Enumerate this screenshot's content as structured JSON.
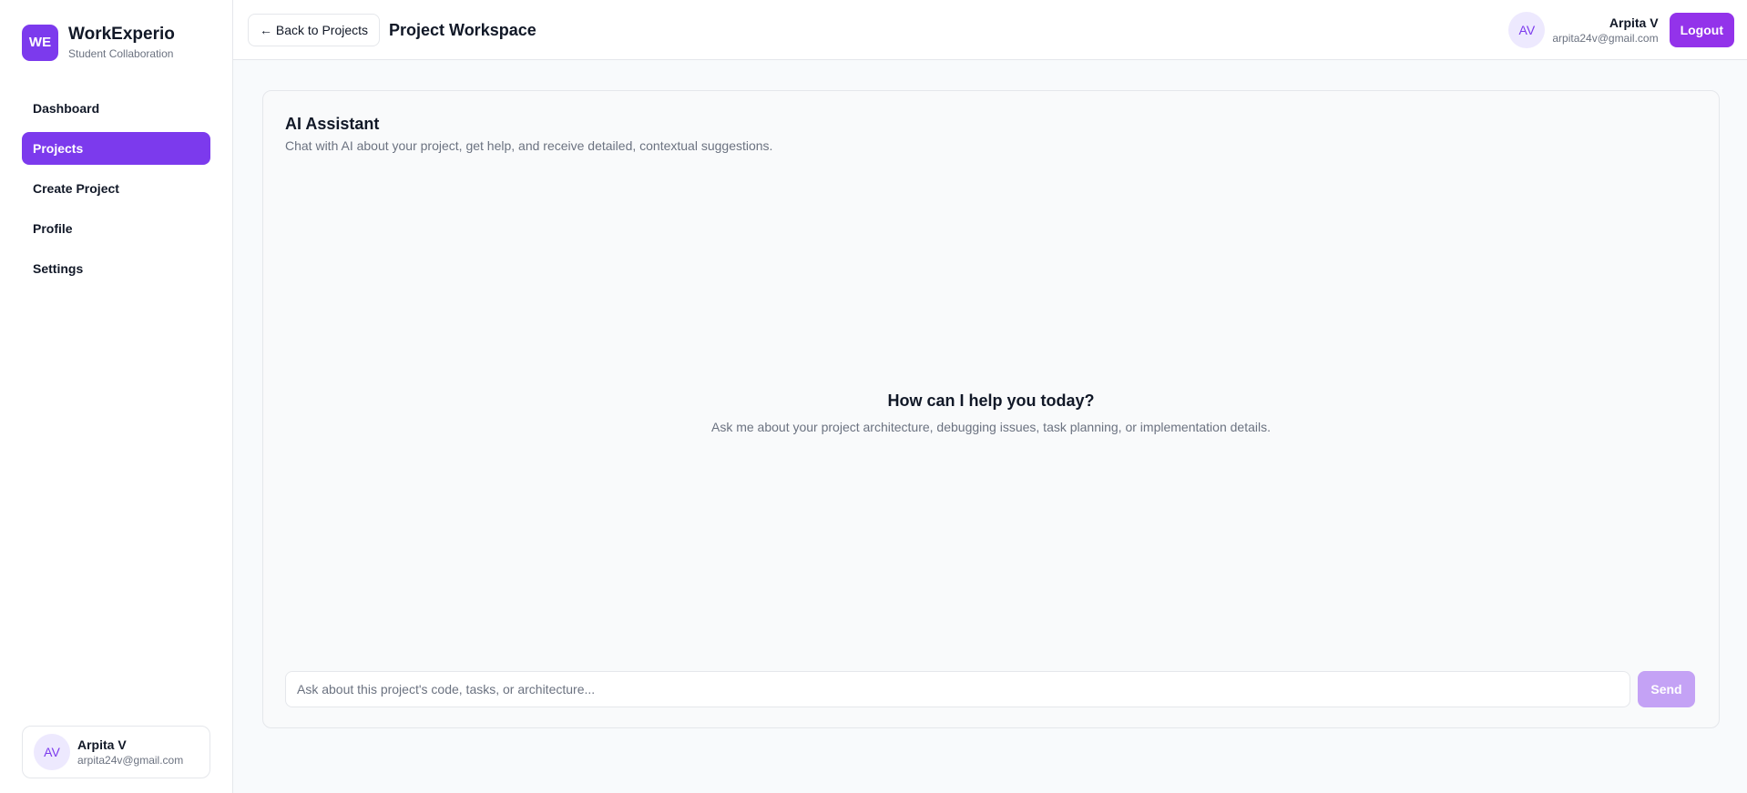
{
  "brand": {
    "logo_text": "WE",
    "name": "WorkExperio",
    "subtitle": "Student Collaboration"
  },
  "sidebar": {
    "items": [
      {
        "label": "Dashboard",
        "active": false
      },
      {
        "label": "Projects",
        "active": true
      },
      {
        "label": "Create Project",
        "active": false
      },
      {
        "label": "Profile",
        "active": false
      },
      {
        "label": "Settings",
        "active": false
      }
    ],
    "user": {
      "initials": "AV",
      "name": "Arpita V",
      "email": "arpita24v@gmail.com"
    }
  },
  "header": {
    "back_label": "← Back to Projects",
    "title": "Project Workspace",
    "user": {
      "initials": "AV",
      "name": "Arpita V",
      "email": "arpita24v@gmail.com"
    },
    "logout_label": "Logout"
  },
  "assistant": {
    "title": "AI Assistant",
    "subtitle": "Chat with AI about your project, get help, and receive detailed, contextual suggestions.",
    "empty_title": "How can I help you today?",
    "empty_subtitle": "Ask me about your project architecture, debugging issues, task planning, or implementation details.",
    "input_placeholder": "Ask about this project's code, tasks, or architecture...",
    "input_value": "",
    "send_label": "Send"
  },
  "colors": {
    "accent": "#7c3aed",
    "logout": "#9333ea",
    "send_disabled": "#c4a2f5",
    "avatar_bg": "#ede9fe"
  }
}
